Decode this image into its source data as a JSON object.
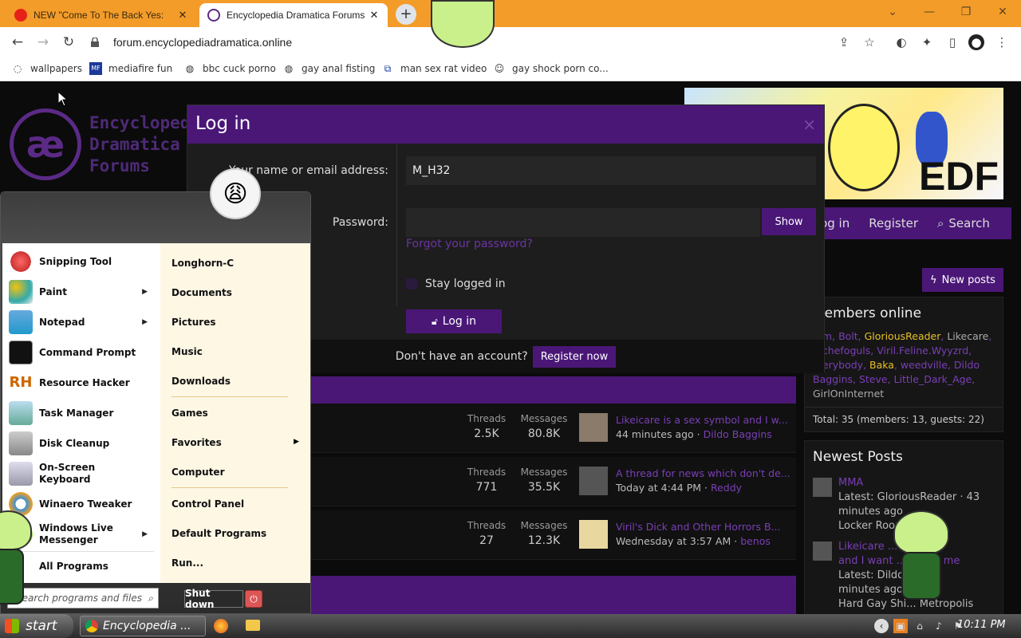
{
  "browser": {
    "tabs": [
      {
        "title": "NEW \"Come To The Back Yes:",
        "active": false
      },
      {
        "title": "Encyclopedia Dramatica Forums",
        "active": true
      }
    ],
    "url": "forum.encyclopediadramatica.online",
    "bookmarks": [
      "wallpapers",
      "mediafire fun",
      "bbc cuck porno",
      "gay anal fisting",
      "man sex rat video",
      "gay shock porn co..."
    ]
  },
  "site": {
    "logo_lines": [
      "Encyclopedia",
      "Dramatica",
      "Forums"
    ],
    "banner_text": "EDF",
    "nav": {
      "login": "Log in",
      "register": "Register",
      "search": "Search"
    },
    "new_posts": "New posts",
    "members_online": {
      "title": "Members online",
      "names": [
        "...m",
        "Bolt",
        "GloriousReader",
        "Likecare",
        "...chefoguls",
        "Viril.Feline.Wyyzrd",
        "...erybody",
        "Baka",
        "weedville",
        "Dildo",
        "Baggins",
        "Steve",
        "Little_Dark_Age",
        "GirlOnInternet"
      ],
      "total": "Total: 35 (members: 13, guests: 22)"
    },
    "newest_posts": {
      "title": "Newest Posts",
      "items": [
        {
          "title": "MMA",
          "meta1": "Latest: GloriousReader · 43",
          "meta2": "minutes ago",
          "meta3": "Locker Room"
        },
        {
          "title": "Likeicare ... symbol",
          "title2": "and I want ... inside me",
          "meta1": "Latest: Dildo ... · 44",
          "meta2": "minutes ago",
          "meta3": "Hard Gay Shi... Metropolis"
        }
      ]
    },
    "forums": [
      {
        "threads_label": "Threads",
        "threads": "2.5K",
        "messages_label": "Messages",
        "messages": "80.8K",
        "last_title": "Likeicare is a sex symbol and I w...",
        "last_time": "44 minutes ago",
        "last_user": "Dildo Baggins"
      },
      {
        "threads_label": "Threads",
        "threads": "771",
        "messages_label": "Messages",
        "messages": "35.5K",
        "last_title": "A thread for news which don't de...",
        "last_time": "Today at 4:44 PM",
        "last_user": "Reddy"
      },
      {
        "threads_label": "Threads",
        "threads": "27",
        "messages_label": "Messages",
        "messages": "12.3K",
        "last_title": "Viril's Dick and Other Horrors B...",
        "last_time": "Wednesday at 3:57 AM",
        "last_user": "benos"
      }
    ]
  },
  "login_modal": {
    "title": "Log in",
    "close": "×",
    "name_label": "Your name or email address:",
    "name_value": "M_H32",
    "password_label": "Password:",
    "show": "Show",
    "forgot": "Forgot your password?",
    "stay": "Stay logged in",
    "login_btn": "Log in",
    "no_account": "Don't have an account?",
    "register": "Register now"
  },
  "start_menu": {
    "left_items": [
      "Snipping Tool",
      "Paint",
      "Notepad",
      "Command Prompt",
      "Resource Hacker",
      "Task Manager",
      "Disk Cleanup",
      "On-Screen Keyboard",
      "Winaero Tweaker",
      "Windows Live Messenger"
    ],
    "all_programs": "All Programs",
    "right_items": [
      "Longhorn-C",
      "Documents",
      "Pictures",
      "Music",
      "Downloads",
      "Games",
      "Favorites",
      "Computer",
      "Control Panel",
      "Default Programs",
      "Run..."
    ],
    "search_placeholder": "Search programs and files",
    "shutdown": "Shut down"
  },
  "taskbar": {
    "start": "start",
    "task": "Encyclopedia ...",
    "clock": "10:11 PM"
  },
  "colors": {
    "purple": "#4a1777",
    "link": "#7a3fb5",
    "chrome_orange": "#f39c2a"
  }
}
